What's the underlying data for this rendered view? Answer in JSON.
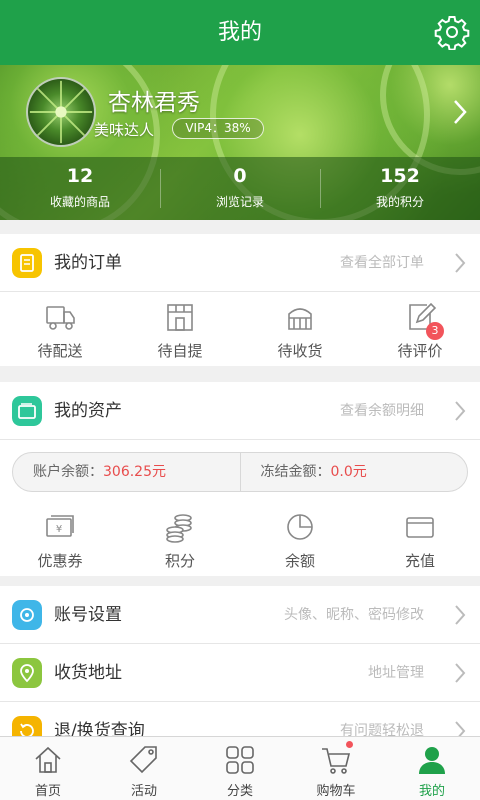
{
  "header": {
    "title": "我的",
    "settings_icon": "gear-icon"
  },
  "profile": {
    "username": "杏林君秀",
    "level": "美味达人",
    "vip_text": "VIP4：38%",
    "stats": [
      {
        "value": "12",
        "label": "收藏的商品"
      },
      {
        "value": "0",
        "label": "浏览记录"
      },
      {
        "value": "152",
        "label": "我的积分"
      }
    ]
  },
  "orders": {
    "title": "我的订单",
    "link": "查看全部订单",
    "items": [
      {
        "label": "待配送",
        "icon": "truck-icon"
      },
      {
        "label": "待自提",
        "icon": "store-icon"
      },
      {
        "label": "待收货",
        "icon": "box-icon"
      },
      {
        "label": "待评价",
        "icon": "edit-icon",
        "badge": "3"
      }
    ]
  },
  "assets": {
    "title": "我的资产",
    "link": "查看余额明细",
    "balance_label": "账户余额：",
    "balance_value": "306.25元",
    "frozen_label": "冻结金额：",
    "frozen_value": "0.0元",
    "items": [
      {
        "label": "优惠券",
        "icon": "coupon-icon"
      },
      {
        "label": "积分",
        "icon": "coins-icon"
      },
      {
        "label": "余额",
        "icon": "pie-icon"
      },
      {
        "label": "充值",
        "icon": "card-icon"
      }
    ]
  },
  "menu": [
    {
      "label": "账号设置",
      "hint": "头像、昵称、密码修改",
      "color": "#3fb6e8",
      "icon": "settings-icon"
    },
    {
      "label": "收货地址",
      "hint": "地址管理",
      "color": "#8cc63f",
      "icon": "location-icon"
    },
    {
      "label": "退/换货查询",
      "hint": "有问题轻松退",
      "color": "#f5b400",
      "icon": "return-icon"
    }
  ],
  "colors": {
    "brand": "#1fa14a",
    "accent_red": "#e84c4c",
    "orders_icon": "#f7c400",
    "assets_icon": "#2ec79a"
  },
  "tabbar": [
    {
      "label": "首页",
      "icon": "home-icon"
    },
    {
      "label": "活动",
      "icon": "tag-icon"
    },
    {
      "label": "分类",
      "icon": "grid-icon"
    },
    {
      "label": "购物车",
      "icon": "cart-icon"
    },
    {
      "label": "我的",
      "icon": "user-icon"
    }
  ]
}
